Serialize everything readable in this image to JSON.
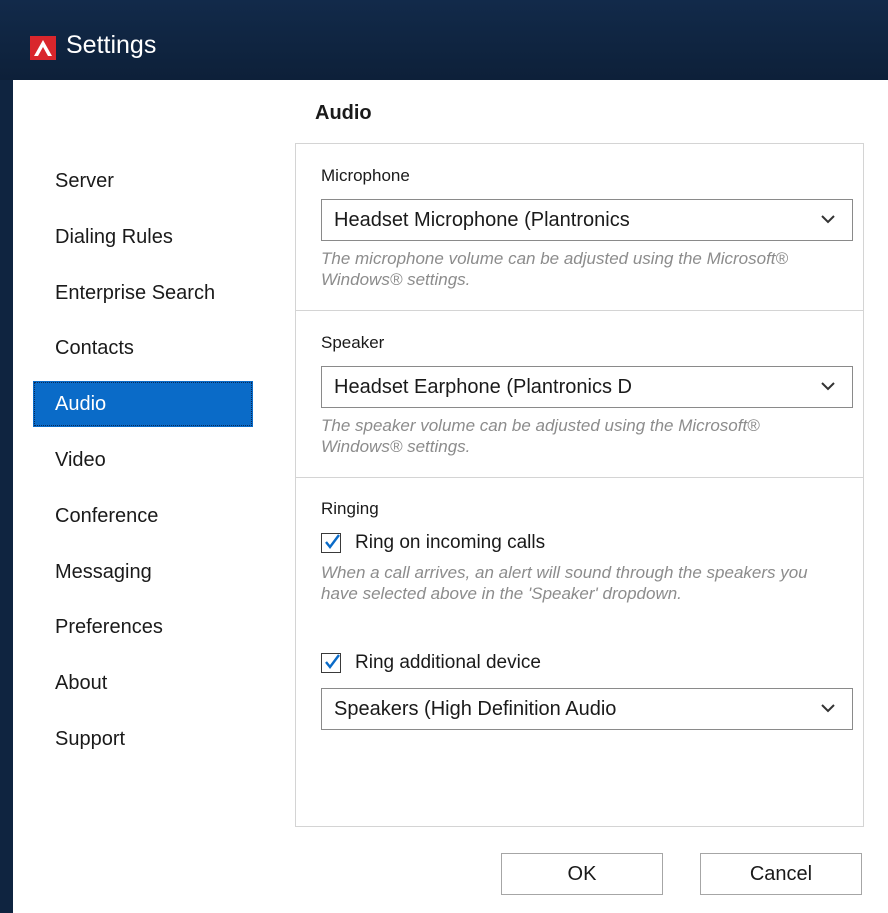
{
  "window": {
    "title": "Settings"
  },
  "sidebar": {
    "items": [
      {
        "label": "Server"
      },
      {
        "label": "Dialing Rules"
      },
      {
        "label": "Enterprise Search"
      },
      {
        "label": "Contacts"
      },
      {
        "label": "Audio",
        "selected": true
      },
      {
        "label": "Video"
      },
      {
        "label": "Conference"
      },
      {
        "label": "Messaging"
      },
      {
        "label": "Preferences"
      },
      {
        "label": "About"
      },
      {
        "label": "Support"
      }
    ]
  },
  "main": {
    "section_title": "Audio",
    "microphone": {
      "label": "Microphone",
      "selected": "Headset Microphone (Plantronics",
      "hint": "The microphone volume can be adjusted using the Microsoft® Windows® settings."
    },
    "speaker": {
      "label": "Speaker",
      "selected": "Headset Earphone (Plantronics D",
      "hint": "The speaker volume can be adjusted using the Microsoft® Windows® settings."
    },
    "ringing": {
      "label": "Ringing",
      "ring_incoming": {
        "label": "Ring on incoming calls",
        "checked": true
      },
      "ring_incoming_hint": "When a call arrives, an alert will sound through the speakers you have selected above in the 'Speaker' dropdown.",
      "ring_additional": {
        "label": "Ring additional device",
        "checked": true
      },
      "additional_device": "Speakers (High Definition Audio"
    }
  },
  "footer": {
    "ok_label": "OK",
    "cancel_label": "Cancel"
  },
  "colors": {
    "accent": "#0a6bc8",
    "titlebar": "#0f2440",
    "logo": "#d9262c"
  }
}
